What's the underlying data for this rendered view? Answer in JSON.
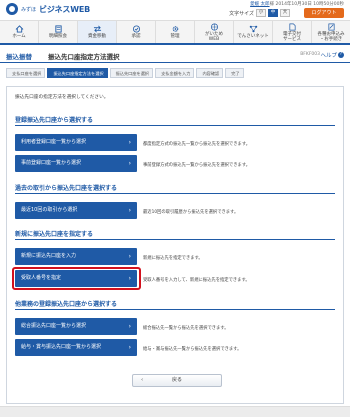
{
  "header": {
    "logo_small": "みずほ",
    "logo_text": "ビジネスWEB",
    "user_prefix": "",
    "user_name": "愛媛 太郎",
    "user_suffix": "様 2014年10月30日 10時50分00秒",
    "font_size_label": "文字サイズ",
    "font_sizes": [
      "小",
      "中",
      "大"
    ],
    "logout_label": "ログアウト"
  },
  "gnav": {
    "items": [
      {
        "label": "ホーム",
        "icon": "home-icon"
      },
      {
        "label": "明細照会",
        "icon": "list-icon"
      },
      {
        "label": "資金移動",
        "icon": "transfer-icon"
      },
      {
        "label": "承認",
        "icon": "approve-icon"
      },
      {
        "label": "管理",
        "icon": "gear-icon"
      },
      {
        "label": "がいため\nWEB",
        "icon": "globe-icon"
      },
      {
        "label": "でんさいネット",
        "icon": "network-icon"
      },
      {
        "label": "電子交付\nサービス",
        "icon": "document-icon"
      },
      {
        "label": "各種お申込み\n・お手続き",
        "icon": "form-icon"
      }
    ]
  },
  "page": {
    "title": "振込振替",
    "subtitle": "振込先口座指定方法選択",
    "page_id": "BFKF003",
    "help_label": "ヘルプ"
  },
  "steps": [
    "支払口座を選択",
    "振込先口座指定方法を選択",
    "振込先口座を選択",
    "支払金額を入力",
    "内容確認",
    "完了"
  ],
  "instruction": "振込先口座の指定方法を選択してください。",
  "sections": [
    {
      "title": "登録振込先口座から選択する",
      "actions": [
        {
          "label": "利用者登録口座一覧から選択",
          "desc": "都度指定方式の振込先一覧から振込先を選択できます。"
        },
        {
          "label": "事前登録口座一覧から選択",
          "desc": "事前登録方式の振込先一覧から振込先を選択できます。"
        }
      ]
    },
    {
      "title": "過去の取引から振込先口座を選択する",
      "actions": [
        {
          "label": "最近10回の取引から選択",
          "desc": "最近10回の取引履歴から振込先を選択できます。"
        }
      ]
    },
    {
      "title": "新規に振込先口座を指定する",
      "actions": [
        {
          "label": "新規に振込先口座を入力",
          "desc": "新規に振込先を指定できます。"
        },
        {
          "label": "受取人番号を指定",
          "desc": "受取人番号を入力して、新規に振込先を指定できます。"
        }
      ]
    },
    {
      "title": "他業務の登録振込先口座から選択する",
      "actions": [
        {
          "label": "総合振込先口座一覧から選択",
          "desc": "総合振込先一覧から振込先を選択できます。"
        },
        {
          "label": "給与・賞与振込先口座一覧から選択",
          "desc": "給与・賞与振込先一覧から振込先を選択できます。"
        }
      ]
    }
  ],
  "back_label": "戻る",
  "colors": {
    "primary": "#1f5aa6",
    "highlight": "#d2111d",
    "logout": "#e46a1c"
  }
}
